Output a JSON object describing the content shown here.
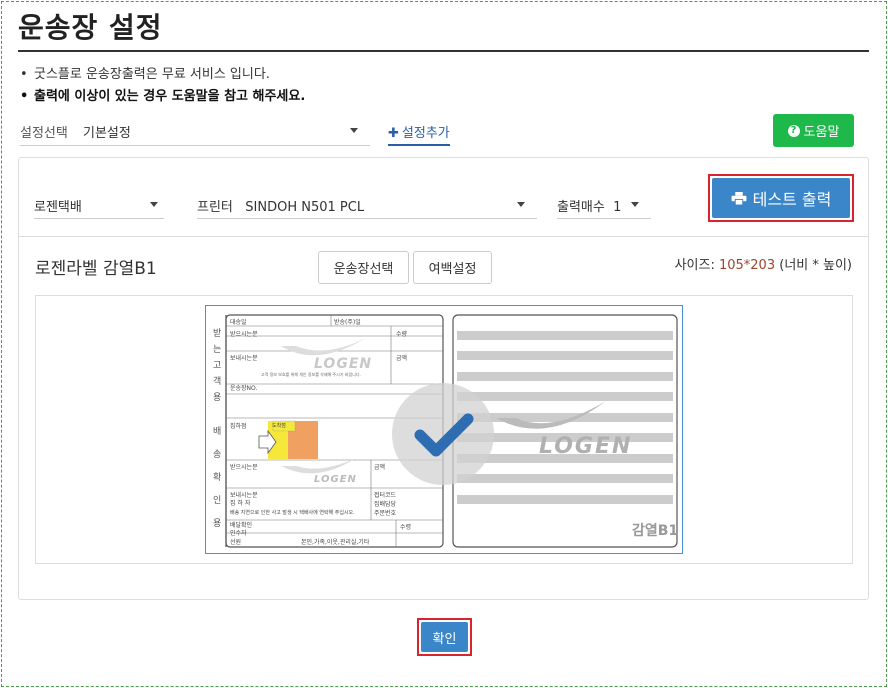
{
  "page": {
    "title": "운송장 설정"
  },
  "notes": [
    "굿스플로 운송장출력은 무료 서비스 입니다.",
    "출력에 이상이 있는 경우 도움말을 참고 해주세요."
  ],
  "settings": {
    "label": "설정선택",
    "selected": "기본설정",
    "add_label": "설정추가",
    "help_label": "도움말"
  },
  "controls": {
    "carrier": "로젠택배",
    "printer_label": "프린터",
    "printer_value": "SINDOH N501 PCL",
    "copies_label": "출력매수",
    "copies_value": "1",
    "test_print": "테스트 출력"
  },
  "label_section": {
    "name": "로젠라벨 감열B1",
    "select_waybill": "운송장선택",
    "margin_setting": "여백설정",
    "size_prefix": "사이즈: ",
    "size_value": "105*203",
    "size_suffix": " (너비 * 높이)"
  },
  "waybill": {
    "logo": "LOGEN",
    "left_col1": "받는고객용",
    "left_col2": "배송확인용",
    "thermal_tag": "감열B1",
    "fields": [
      "대송일",
      "받송(주)일",
      "받으시는분",
      "수량",
      "보내시는분",
      "금액",
      "운송장NO.",
      "집하점",
      "도착점",
      "받으시는분",
      "금액",
      "보내시는분",
      "접터코드",
      "집 하 자",
      "집배담당",
      "주문번호",
      "배달확인",
      "수령",
      "인수자",
      "선원",
      "본인,가족,이웃,관리실,기타"
    ],
    "note_line": "고객 정보 보호를 위해 개인 정보를 삭제해 주시기 바랍니다.",
    "note_line2": "배송 지연으로 인한 사고 발생 시 택배사에 연락해 주십시오."
  },
  "footer": {
    "confirm": "확인"
  },
  "colors": {
    "accent_blue": "#3a86c8",
    "help_green": "#1fb84b",
    "highlight_red": "#d9232d",
    "size_text": "#a0432d"
  }
}
